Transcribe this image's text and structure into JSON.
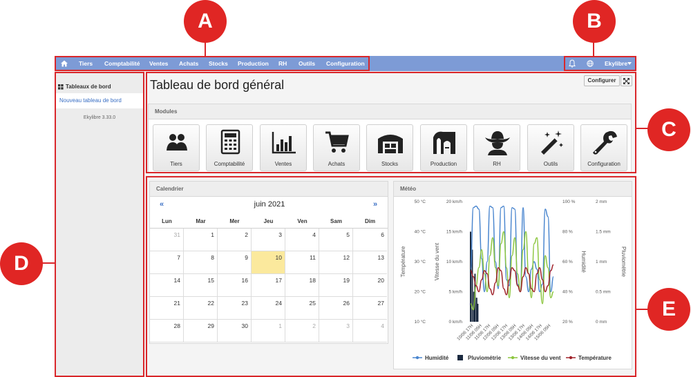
{
  "annotations": {
    "a": "A",
    "b": "B",
    "c": "C",
    "d": "D",
    "e": "E"
  },
  "colors": {
    "navbar": "#7d9bd6",
    "accent_red": "#e02624",
    "link_blue": "#3a6fc4",
    "today": "#fbe99d"
  },
  "navbar": {
    "home_icon": "home-icon",
    "items": [
      "Tiers",
      "Comptabilité",
      "Ventes",
      "Achats",
      "Stocks",
      "Production",
      "RH",
      "Outils",
      "Configuration"
    ],
    "bell_icon": "bell-icon",
    "globe_icon": "globe-icon",
    "user_label": "Ekylibre"
  },
  "sidebar": {
    "section_title": "Tableaux de bord",
    "section_icon": "dashboard-grid-icon",
    "link": "Nouveau tableau de bord",
    "version": "Ekylibre 3.33.0"
  },
  "main": {
    "title": "Tableau de bord général",
    "configure_button": "Configurer",
    "expand_icon": "expand-arrows-icon",
    "modules_title": "Modules",
    "modules": [
      {
        "label": "Tiers",
        "icon": "people-icon"
      },
      {
        "label": "Comptabilité",
        "icon": "calculator-icon"
      },
      {
        "label": "Ventes",
        "icon": "bar-chart-icon"
      },
      {
        "label": "Achats",
        "icon": "cart-icon"
      },
      {
        "label": "Stocks",
        "icon": "warehouse-icon"
      },
      {
        "label": "Production",
        "icon": "barn-icon"
      },
      {
        "label": "RH",
        "icon": "farmer-icon"
      },
      {
        "label": "Outils",
        "icon": "magic-wand-icon"
      },
      {
        "label": "Configuration",
        "icon": "wrench-icon"
      }
    ]
  },
  "calendar": {
    "title": "Calendrier",
    "month": "juin 2021",
    "prev": "«",
    "next": "»",
    "weekdays": [
      "Lun",
      "Mar",
      "Mer",
      "Jeu",
      "Ven",
      "Sam",
      "Dim"
    ],
    "weeks": [
      [
        "31",
        "1",
        "2",
        "3",
        "4",
        "5",
        "6"
      ],
      [
        "7",
        "8",
        "9",
        "10",
        "11",
        "12",
        "13"
      ],
      [
        "14",
        "15",
        "16",
        "17",
        "18",
        "19",
        "20"
      ],
      [
        "21",
        "22",
        "23",
        "24",
        "25",
        "26",
        "27"
      ],
      [
        "28",
        "29",
        "30",
        "1",
        "2",
        "3",
        "4"
      ]
    ],
    "today": "10"
  },
  "meteo": {
    "title": "Météo",
    "chart_data": {
      "type": "line",
      "axes": {
        "temperature": {
          "title": "Température",
          "ticks": [
            "50 °C",
            "40 °C",
            "30 °C",
            "20 °C",
            "10 °C"
          ],
          "range": [
            10,
            50
          ]
        },
        "wind": {
          "title": "Vitesse du vent",
          "ticks": [
            "20 km/h",
            "15 km/h",
            "10 km/h",
            "5 km/h",
            "0 km/h"
          ],
          "range": [
            0,
            20
          ]
        },
        "humidity": {
          "title": "Humidité",
          "ticks": [
            "100 %",
            "80 %",
            "60 %",
            "40 %",
            "20 %"
          ],
          "range": [
            20,
            100
          ]
        },
        "rain": {
          "title": "Pluviométrie",
          "ticks": [
            "2 mm",
            "1.5 mm",
            "1 mm",
            "0.5 mm",
            "0 mm"
          ],
          "range": [
            0,
            2
          ]
        }
      },
      "x": [
        "10/06 17H",
        "11/06 05H",
        "11/06 17H",
        "12/06 05H",
        "12/06 17H",
        "13/06 05H",
        "13/06 17H",
        "14/06 05H",
        "14/06 17H",
        "15/06 05H"
      ],
      "series": [
        {
          "name": "Humidité",
          "axis": "humidity",
          "color": "#4a86cf",
          "values": [
            55,
            96,
            97,
            95,
            62,
            40,
            60,
            97,
            96,
            60,
            42,
            96,
            97,
            48,
            44,
            96,
            95,
            45,
            40,
            96,
            50,
            40,
            55,
            60,
            55,
            40,
            45,
            95,
            90,
            40,
            50
          ]
        },
        {
          "name": "Pluviométrie",
          "axis": "rain",
          "color": "#1b2a40",
          "bars": [
            [
              0,
              1.5
            ],
            [
              0.6,
              1.2
            ],
            [
              1.2,
              0.5
            ],
            [
              1.6,
              0.8
            ],
            [
              2.2,
              0.4
            ],
            [
              2.6,
              0.3
            ]
          ]
        },
        {
          "name": "Vitesse du vent",
          "axis": "wind",
          "color": "#8cc63e",
          "values": [
            3,
            2,
            6,
            9,
            12,
            8,
            5,
            11,
            14,
            9,
            6,
            13,
            15,
            9,
            4,
            11,
            14,
            8,
            5,
            12,
            15,
            8,
            4,
            13,
            14,
            7,
            3,
            11,
            9,
            4,
            5
          ]
        },
        {
          "name": "Température",
          "axis": "temperature",
          "color": "#a0222a",
          "values": [
            27,
            25,
            22,
            20,
            24,
            27,
            26,
            21,
            19,
            23,
            28,
            27,
            21,
            19,
            24,
            28,
            27,
            22,
            20,
            25,
            28,
            26,
            21,
            20,
            26,
            28,
            24,
            20,
            22,
            27,
            29
          ]
        }
      ]
    },
    "legend": [
      "Humidité",
      "Pluviométrie",
      "Vitesse du vent",
      "Température"
    ]
  }
}
